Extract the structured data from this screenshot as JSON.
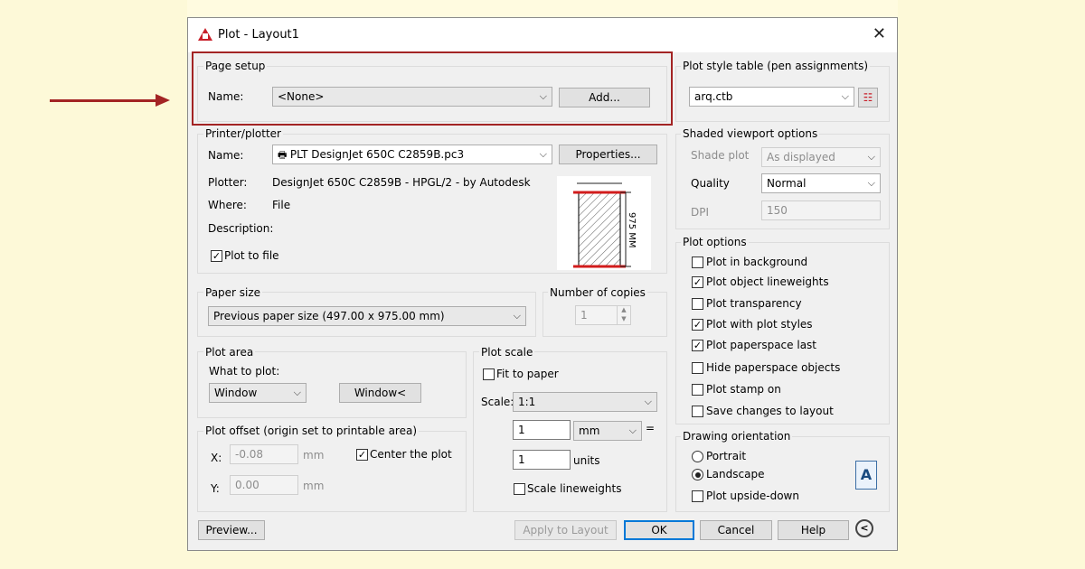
{
  "dialog": {
    "title": "Plot - Layout1"
  },
  "page_setup": {
    "legend": "Page setup",
    "name_label": "Name:",
    "name_value": "<None>",
    "add_button": "Add..."
  },
  "printer": {
    "legend": "Printer/plotter",
    "name_label": "Name:",
    "name_value": "PLT DesignJet 650C C2859B.pc3",
    "properties_button": "Properties...",
    "plotter_label": "Plotter:",
    "plotter_value": "DesignJet 650C C2859B - HPGL/2 - by Autodesk",
    "where_label": "Where:",
    "where_value": "File",
    "description_label": "Description:",
    "plot_to_file": "Plot to file",
    "paper_dim": "975 MM"
  },
  "paper_size": {
    "legend": "Paper size",
    "value": "Previous paper size  (497.00 x 975.00 mm)"
  },
  "copies": {
    "legend": "Number of copies",
    "value": "1"
  },
  "plot_area": {
    "legend": "Plot area",
    "what_label": "What to plot:",
    "what_value": "Window",
    "window_button": "Window<"
  },
  "plot_offset": {
    "legend": "Plot offset (origin set to printable area)",
    "x_label": "X:",
    "x_value": "-0.08",
    "x_unit": "mm",
    "y_label": "Y:",
    "y_value": "0.00",
    "y_unit": "mm",
    "center": "Center the plot"
  },
  "plot_scale": {
    "legend": "Plot scale",
    "fit": "Fit to paper",
    "scale_label": "Scale:",
    "scale_value": "1:1",
    "value1": "1",
    "unit1": "mm",
    "equals": "=",
    "value2": "1",
    "unit2": "units",
    "scale_lw": "Scale lineweights"
  },
  "style_table": {
    "legend": "Plot style table (pen assignments)",
    "value": "arq.ctb"
  },
  "shaded": {
    "legend": "Shaded viewport options",
    "shade_label": "Shade plot",
    "shade_value": "As displayed",
    "quality_label": "Quality",
    "quality_value": "Normal",
    "dpi_label": "DPI",
    "dpi_value": "150"
  },
  "plot_options": {
    "legend": "Plot options",
    "items": [
      {
        "label": "Plot in background",
        "checked": false
      },
      {
        "label": "Plot object lineweights",
        "checked": true
      },
      {
        "label": "Plot transparency",
        "checked": false
      },
      {
        "label": "Plot with plot styles",
        "checked": true
      },
      {
        "label": "Plot paperspace last",
        "checked": true
      },
      {
        "label": "Hide paperspace objects",
        "checked": false
      },
      {
        "label": "Plot stamp on",
        "checked": false
      },
      {
        "label": "Save changes to layout",
        "checked": false
      }
    ]
  },
  "orientation": {
    "legend": "Drawing orientation",
    "portrait": "Portrait",
    "landscape": "Landscape",
    "upside": "Plot upside-down",
    "selected": "Landscape",
    "icon_letter": "A"
  },
  "footer": {
    "preview": "Preview...",
    "apply": "Apply to Layout",
    "ok": "OK",
    "cancel": "Cancel",
    "help": "Help"
  },
  "colors": {
    "annotation_red": "#a32424",
    "accent_blue": "#0078d7"
  }
}
